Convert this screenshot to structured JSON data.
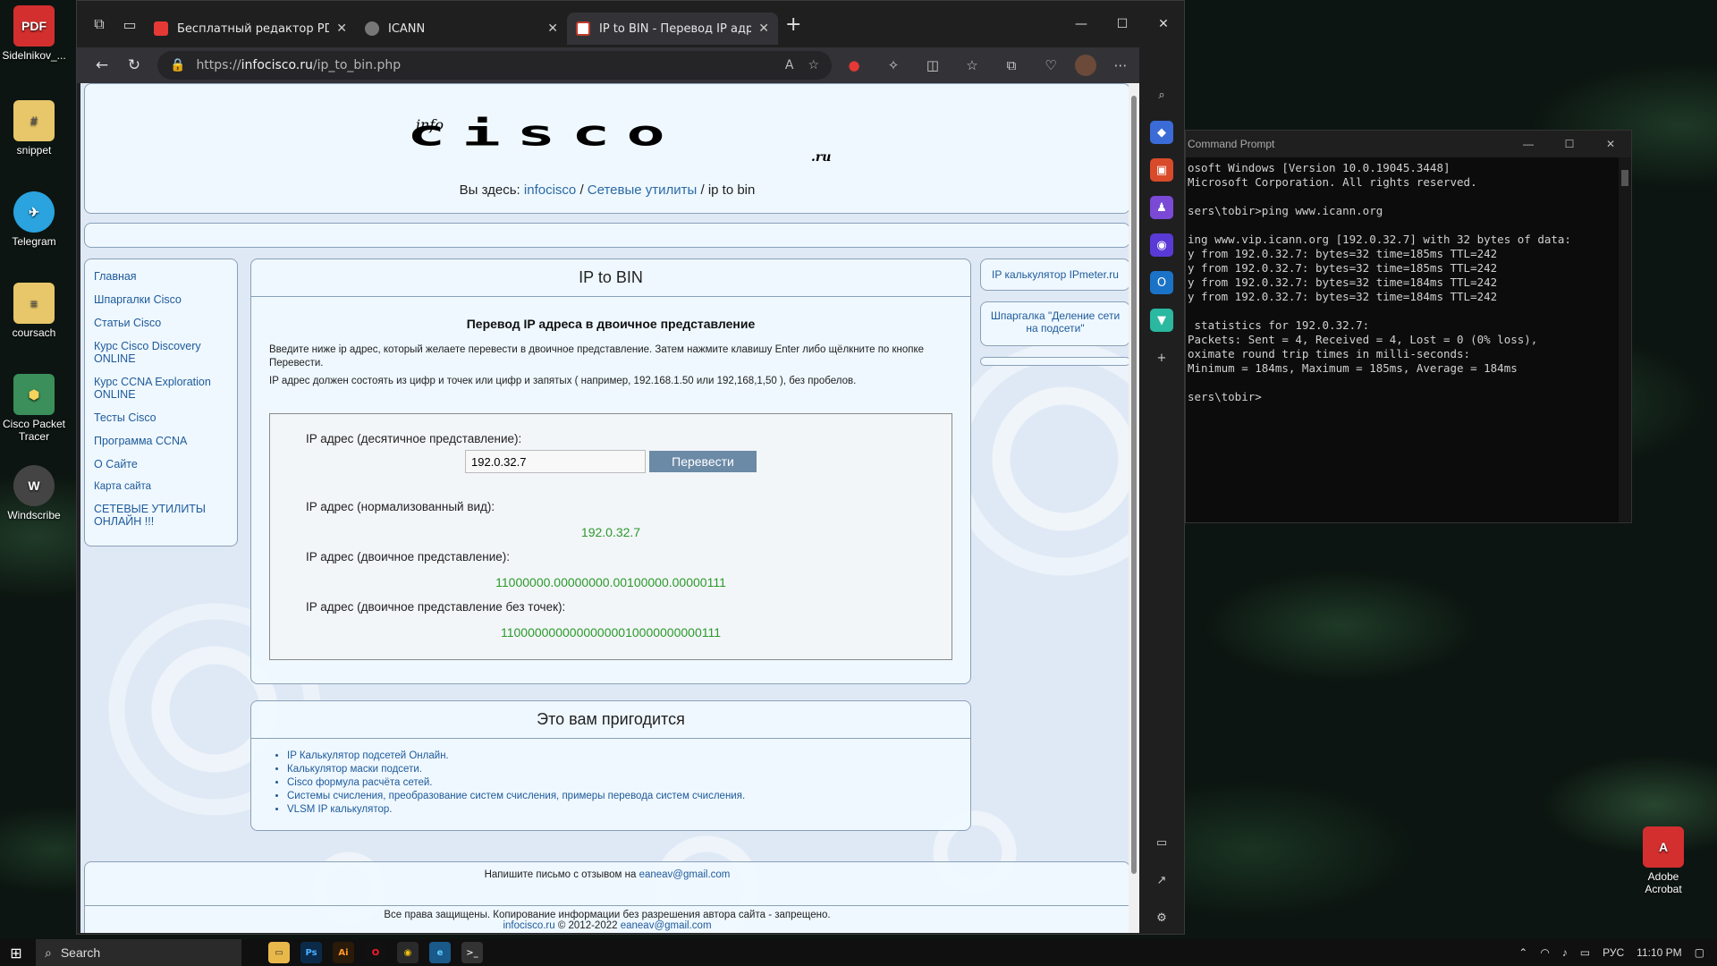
{
  "desktop": {
    "icons": [
      {
        "label": "Sidelnikov_...",
        "glyph": "PDF",
        "color": "#d32f2f"
      },
      {
        "label": "snippet",
        "glyph": "#",
        "color": "#e8c66a"
      },
      {
        "label": "Telegram",
        "glyph": "✈",
        "color": "#2aa3df"
      },
      {
        "label": "coursach",
        "glyph": "≡",
        "color": "#e8c66a"
      },
      {
        "label": "Cisco Packet Tracer",
        "glyph": "⬢",
        "color": "#3a8f5a"
      },
      {
        "label": "Windscribe",
        "glyph": "W",
        "color": "#555"
      },
      {
        "label": "Adobe Acrobat",
        "glyph": "A",
        "color": "#d32f2f"
      }
    ]
  },
  "browser": {
    "tabs": [
      {
        "title": "Бесплатный редактор PDF-фай",
        "fav_color": "#e53935"
      },
      {
        "title": "ICANN",
        "fav_color": "#777"
      },
      {
        "title": "IP to BIN - Перевод IP адреса в",
        "fav_color": "#ffffff"
      }
    ],
    "url_prefix": "https://",
    "url_host": "infocisco.ru",
    "url_path": "/ip_to_bin.php"
  },
  "page": {
    "logo_small": "info",
    "logo_main": "cisco",
    "logo_suffix": ".ru",
    "crumb_prefix": "Вы здесь:",
    "crumb_1": "infocisco",
    "crumb_2": "Сетевые утилиты",
    "crumb_3": "ip to bin",
    "sep": "/",
    "menu": [
      "Главная",
      "Шпаргалки Cisco",
      "Статьи Cisco",
      "Курс Cisco Discovery ONLINE",
      "Курс CCNA Exploration ONLINE",
      "Тесты Cisco",
      "Программа CCNA",
      "О Сайте",
      "Карта сайта",
      "СЕТЕВЫЕ УТИЛИТЫ ОНЛАЙН !!!"
    ],
    "main_title": "IP to BIN",
    "subtitle": "Перевод IP адреса в двоичное представление",
    "desc_1": "Введите ниже ip адрес, который желаете перевести в двоичное представление. Затем нажмите клавишу Enter либо щёлкните по кнопке Перевести.",
    "desc_2": "IP адрес должен состоять из цифр и точек или цифр и запятых ( например, 192.168.1.50 или 192,168,1,50 ), без пробелов.",
    "label_decimal": "IP адрес (десятичное представление):",
    "input_value": "192.0.32.7",
    "button_label": "Перевести",
    "label_normalized": "IP адрес (нормализованный вид):",
    "value_normalized": "192.0.32.7",
    "label_binary": "IP адрес (двоичное представление):",
    "value_binary": "11000000.00000000.00100000.00000111",
    "label_binary_nodots": "IP адрес (двоичное представление без точек):",
    "value_binary_nodots": "11000000000000000010000000000111",
    "useful_title": "Это вам пригодится",
    "useful_links": [
      "IP Калькулятор подсетей Онлайн.",
      "Калькулятор маски подсети.",
      "Cisco формула расчёта сетей.",
      "Системы счисления, преобразование систем счисления, примеры перевода систем счисления.",
      "VLSM IP калькулятор."
    ],
    "right_link_1": "IP калькулятор IPmeter.ru",
    "right_link_2": "Шпаргалка \"Деление сети на подсети\"",
    "feedback_text": "Напишите письмо с отзывом на",
    "feedback_email": "eaneav@gmail.com",
    "copyright": "Все права защищены. Копирование информации без разрешения автора сайта - запрещено.",
    "footer_site": "infocisco.ru",
    "footer_years": "© 2012-2022",
    "footer_email": "eaneav@gmail.com"
  },
  "terminal": {
    "title": "Command Prompt",
    "lines": "osoft Windows [Version 10.0.19045.3448]\nMicrosoft Corporation. All rights reserved.\n\nsers\\tobir>ping www.icann.org\n\ning www.vip.icann.org [192.0.32.7] with 32 bytes of data:\ny from 192.0.32.7: bytes=32 time=185ms TTL=242\ny from 192.0.32.7: bytes=32 time=185ms TTL=242\ny from 192.0.32.7: bytes=32 time=184ms TTL=242\ny from 192.0.32.7: bytes=32 time=184ms TTL=242\n\n statistics for 192.0.32.7:\nPackets: Sent = 4, Received = 4, Lost = 0 (0% loss),\noximate round trip times in milli-seconds:\nMinimum = 184ms, Maximum = 185ms, Average = 184ms\n\nsers\\tobir>"
  },
  "taskbar": {
    "search": "Search",
    "lang": "РУС",
    "time": "11:10 PM"
  }
}
